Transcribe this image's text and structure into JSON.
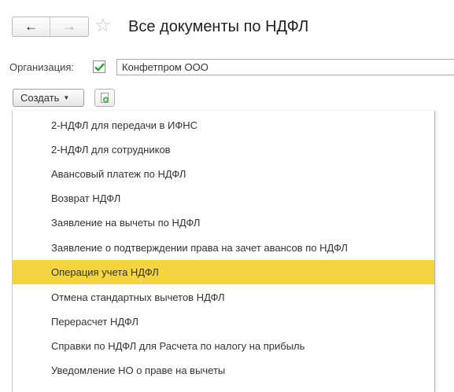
{
  "header": {
    "title": "Все документы по НДФЛ",
    "back_icon": "arrow-left-icon",
    "forward_icon": "arrow-right-icon",
    "favorite_icon": "star-icon"
  },
  "filter": {
    "org_label": "Организация:",
    "org_checked": true,
    "org_value": "Конфетпром ООО"
  },
  "toolbar": {
    "create_label": "Создать",
    "add_icon": "copy-add-icon"
  },
  "menu": {
    "items": [
      {
        "label": "2-НДФЛ для передачи в ИФНС"
      },
      {
        "label": "2-НДФЛ для сотрудников"
      },
      {
        "label": "Авансовый платеж по НДФЛ"
      },
      {
        "label": "Возврат НДФЛ"
      },
      {
        "label": "Заявление на вычеты по НДФЛ"
      },
      {
        "label": "Заявление о подтверждении права на зачет авансов по НДФЛ"
      },
      {
        "label": "Операция учета НДФЛ"
      },
      {
        "label": "Отмена стандартных вычетов НДФЛ"
      },
      {
        "label": "Перерасчет НДФЛ"
      },
      {
        "label": "Справки по НДФЛ для Расчета по налогу на прибыль"
      },
      {
        "label": "Уведомление НО о праве на вычеты"
      }
    ],
    "selected_index": 6
  },
  "colors": {
    "highlight": "#f5d441",
    "check": "#2f9a2f"
  }
}
